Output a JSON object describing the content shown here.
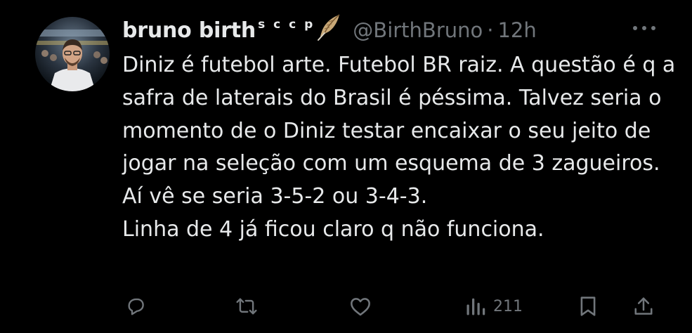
{
  "author": {
    "display_name": "bruno birth",
    "name_superscript": "s c c p",
    "handle": "@BirthBruno",
    "separator": "·",
    "timestamp": "12h",
    "avatar_icon": "profile-photo",
    "badge_icon": "feather-icon"
  },
  "tweet": {
    "text": "Diniz é futebol arte. Futebol BR raiz. A questão é q a safra de laterais do Brasil é péssima. Talvez seria o momento de o Diniz testar encaixar o seu jeito de jogar na seleção com um esquema de 3 zagueiros. Aí vê se seria 3-5-2 ou 3-4-3.\nLinha de 4 já ficou claro q não funciona."
  },
  "actions": {
    "reply_icon": "reply-icon",
    "retweet_icon": "retweet-icon",
    "like_icon": "heart-icon",
    "views_icon": "views-icon",
    "views_count": "211",
    "bookmark_icon": "bookmark-icon",
    "share_icon": "share-icon"
  },
  "menu": {
    "more_icon": "more-icon"
  },
  "colors": {
    "background": "#000000",
    "primary_text": "#e7e9ea",
    "secondary_text": "#71767b"
  }
}
